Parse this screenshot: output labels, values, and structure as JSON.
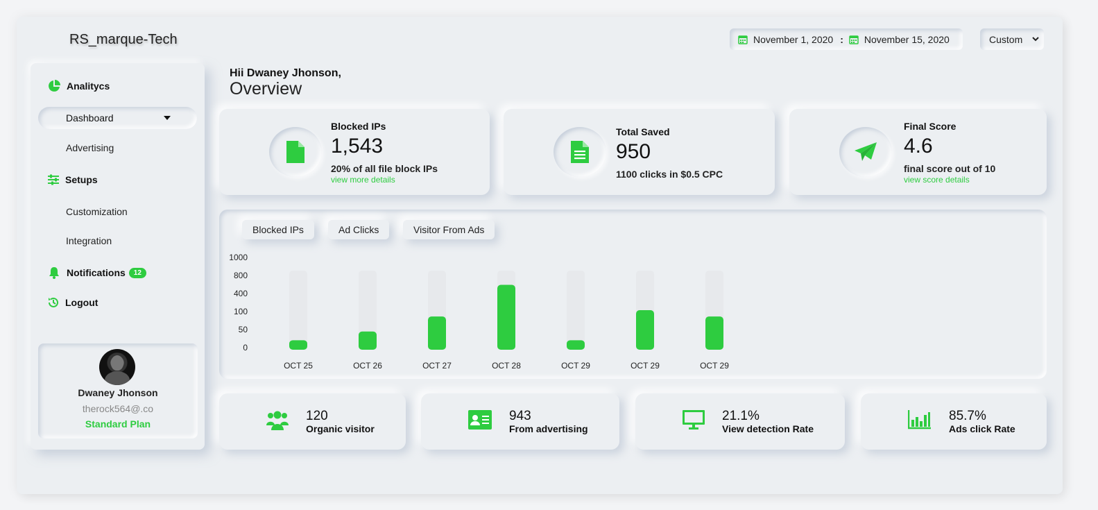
{
  "header": {
    "brand": "RS_marque-Tech",
    "date_start": "November 1, 2020",
    "date_sep": ":",
    "date_end": "November 15, 2020",
    "range_select": "Custom"
  },
  "sidebar": {
    "analytics_label": "Analitycs",
    "dashboard_label": "Dashboard",
    "advertising_label": "Advertising",
    "setups_label": "Setups",
    "customization_label": "Customization",
    "integration_label": "Integration",
    "notifications_label": "Notifications",
    "notifications_count": "12",
    "logout_label": "Logout"
  },
  "profile": {
    "name": "Dwaney Jhonson",
    "email": "therock564@.co",
    "plan": "Standard Plan"
  },
  "greeting": {
    "hello": "Hii Dwaney Jhonson,",
    "title": "Overview"
  },
  "stats": [
    {
      "title": "Blocked IPs",
      "value": "1,543",
      "sub": "20% of all file block IPs",
      "link": "view more details",
      "icon": "file-icon"
    },
    {
      "title": "Total Saved",
      "value": "950",
      "sub": "1100 clicks in $0.5 CPC",
      "link": "",
      "icon": "document-icon"
    },
    {
      "title": "Final Score",
      "value": "4.6",
      "sub": "final score out of 10",
      "link": "view score details",
      "icon": "paper-plane-icon"
    }
  ],
  "chart_tabs": [
    "Blocked IPs",
    "Ad Clicks",
    "Visitor From Ads"
  ],
  "chart_data": {
    "type": "bar",
    "y_ticks": [
      "1000",
      "800",
      "400",
      "100",
      "50",
      "0"
    ],
    "categories": [
      "OCT 25",
      "OCT 26",
      "OCT 27",
      "OCT 28",
      "OCT 29",
      "OCT 29",
      "OCT 29"
    ],
    "fill_fraction": [
      0.12,
      0.23,
      0.42,
      0.82,
      0.12,
      0.5,
      0.42
    ],
    "colors": {
      "bar": "#2ecc40",
      "track": "#e7e9ec"
    },
    "grid": false
  },
  "summary": [
    {
      "value": "120",
      "label": "Organic visitor",
      "icon": "users-icon"
    },
    {
      "value": "943",
      "label": "From advertising",
      "icon": "id-card-icon"
    },
    {
      "value": "21.1%",
      "label": "View detection Rate",
      "icon": "monitor-icon"
    },
    {
      "value": "85.7%",
      "label": "Ads click Rate",
      "icon": "bar-chart-icon"
    }
  ],
  "colors": {
    "accent": "#2ecc40",
    "background": "#eceff2"
  }
}
